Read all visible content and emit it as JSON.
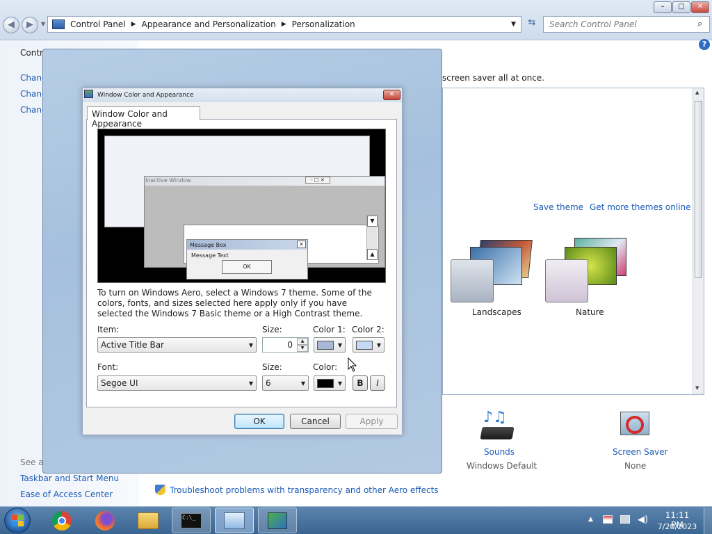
{
  "explorer": {
    "breadcrumb": [
      "Control Panel",
      "Appearance and Personalization",
      "Personalization"
    ],
    "search_placeholder": "Search Control Panel",
    "window_controls": [
      "–",
      "□",
      "✕"
    ]
  },
  "background": {
    "left_items": [
      "Contro",
      "Chang",
      "Chang",
      "Chang"
    ],
    "see_also": "See als",
    "taskbar_link": "Taskbar and Start Menu",
    "ease_link": "Ease of Access Center",
    "header_text": "screen saver all at once.",
    "save_theme": "Save theme",
    "get_more": "Get more themes online",
    "themes": [
      {
        "name": "Landscapes"
      },
      {
        "name": "Nature"
      }
    ],
    "sounds": {
      "label": "Sounds",
      "value": "Windows Default"
    },
    "screen_saver": {
      "label": "Screen Saver",
      "value": "None"
    },
    "troubleshoot": "Troubleshoot problems with transparency and other Aero effects"
  },
  "dialog": {
    "title": "Window Color and Appearance",
    "tab": "Window Color and Appearance",
    "preview": {
      "inactive_title": "Inactive Window",
      "message_box_title": "Message Box",
      "message_text": "Message Text",
      "ok": "OK"
    },
    "description": "To turn on Windows Aero, select a Windows 7 theme.  Some of the colors, fonts, and sizes selected here apply only if you have selected the Windows 7 Basic theme or a High Contrast theme.",
    "item_label": "Item:",
    "item_value": "Active Title Bar",
    "size_label": "Size:",
    "size_value": "0",
    "color1_label": "Color 1:",
    "color2_label": "Color 2:",
    "font_label": "Font:",
    "font_value": "Segoe UI",
    "font_size_label": "Size:",
    "font_size_value": "6",
    "color_label": "Color:",
    "bold": "B",
    "italic": "I",
    "ok": "OK",
    "cancel": "Cancel",
    "apply": "Apply",
    "colors": {
      "color1": "#a6b8d6",
      "color2": "#c6d8f4",
      "font_color": "#000000"
    }
  },
  "taskbar": {
    "time": "11:11 PM",
    "date": "7/20/2023"
  }
}
